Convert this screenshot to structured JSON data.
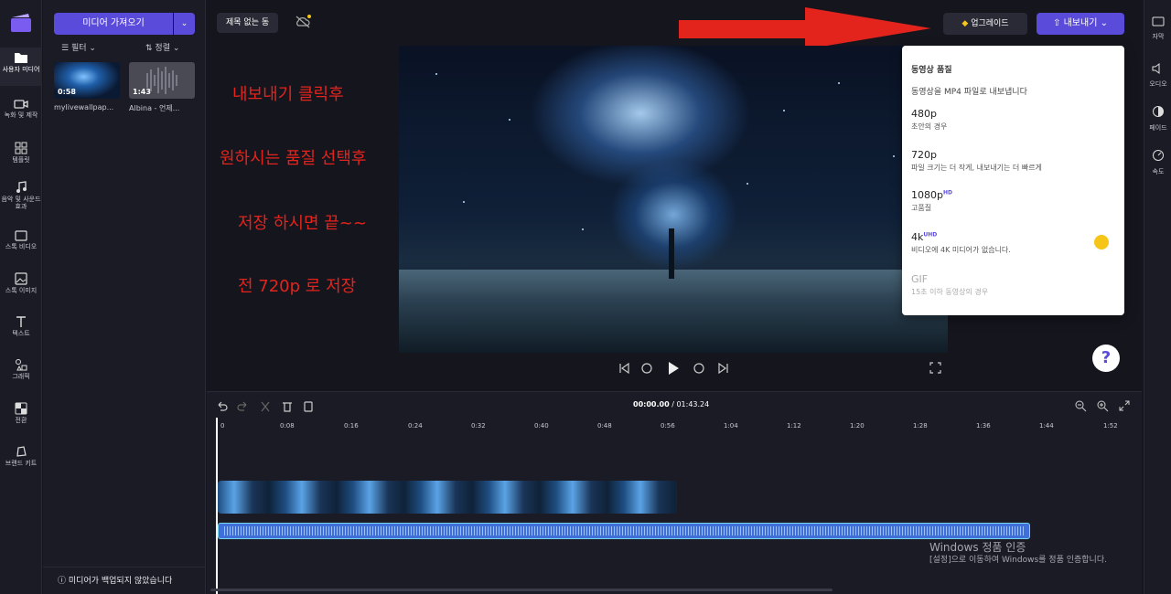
{
  "nav": {
    "items": [
      {
        "label": "사용자 미디어"
      },
      {
        "label": "녹화 및 제작"
      },
      {
        "label": "템플릿"
      },
      {
        "label": "음악 및 사운드 효과"
      },
      {
        "label": "스톡 비디오"
      },
      {
        "label": "스톡 이미지"
      },
      {
        "label": "텍스트"
      },
      {
        "label": "그래픽"
      },
      {
        "label": "전환"
      },
      {
        "label": "브랜드 키트"
      }
    ]
  },
  "media": {
    "import_label": "미디어 가져오기",
    "filter_label": "필터",
    "sort_label": "정렬",
    "items": [
      {
        "duration": "0:58",
        "name": "mylivewallpap..."
      },
      {
        "duration": "1:43",
        "name": "Albina - 언제..."
      }
    ],
    "backup_notice": "미디어가 백업되지 않았습니다"
  },
  "topbar": {
    "project_title": "제목 없는 동",
    "upgrade_label": "업그레이드",
    "export_label": "내보내기"
  },
  "annotations": [
    "내보내기 클릭후",
    "원하시는 품질 선택후",
    "저장 하시면 끝~~",
    "전 720p 로 저장"
  ],
  "export_menu": {
    "heading": "동영상 품질",
    "description": "동영상을 MP4 파일로 내보냅니다",
    "options": [
      {
        "title": "480p",
        "badge": "",
        "sub": "초안의 경우"
      },
      {
        "title": "720p",
        "badge": "",
        "sub": "파일 크기는 더 작게, 내보내기는 더 빠르게"
      },
      {
        "title": "1080p",
        "badge": "HD",
        "sub": "고품질"
      },
      {
        "title": "4k",
        "badge": "UHD",
        "sub": "비디오에 4K 미디어가 없습니다."
      },
      {
        "title": "GIF",
        "badge": "",
        "sub": "15초 이하 동영상의 경우"
      }
    ]
  },
  "right_panel": {
    "items": [
      {
        "label": "자막"
      },
      {
        "label": "오디오"
      },
      {
        "label": "페이드"
      },
      {
        "label": "속도"
      }
    ]
  },
  "timeline": {
    "current_time": "00:00.00",
    "total_time": "01:43.24",
    "ticks": [
      "0",
      "0:08",
      "0:16",
      "0:24",
      "0:32",
      "0:40",
      "0:48",
      "0:56",
      "1:04",
      "1:12",
      "1:20",
      "1:28",
      "1:36",
      "1:44",
      "1:52"
    ]
  },
  "watermark": {
    "line1": "Windows 정품 인증",
    "line2": "[설정]으로 이동하여 Windows를 정품 인증합니다."
  },
  "colors": {
    "accent": "#5b4bdb",
    "annotation": "#e3241c",
    "premium": "#f5c518"
  }
}
